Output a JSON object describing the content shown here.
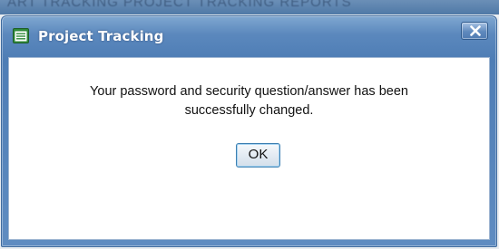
{
  "background": {
    "ghost_text": "ART TRACKING   PROJECT TRACKING   REPORTS"
  },
  "dialog": {
    "title": "Project Tracking",
    "title_icon": "list-window-icon",
    "close_icon": "close-icon",
    "message_line1": "Your password and security question/answer has been",
    "message_line2": "successfully changed.",
    "ok_label": "OK"
  },
  "colors": {
    "titlebar": "#5b88bd",
    "close_button": "#5f89bd",
    "ok_button_border": "#3c7fb1"
  }
}
